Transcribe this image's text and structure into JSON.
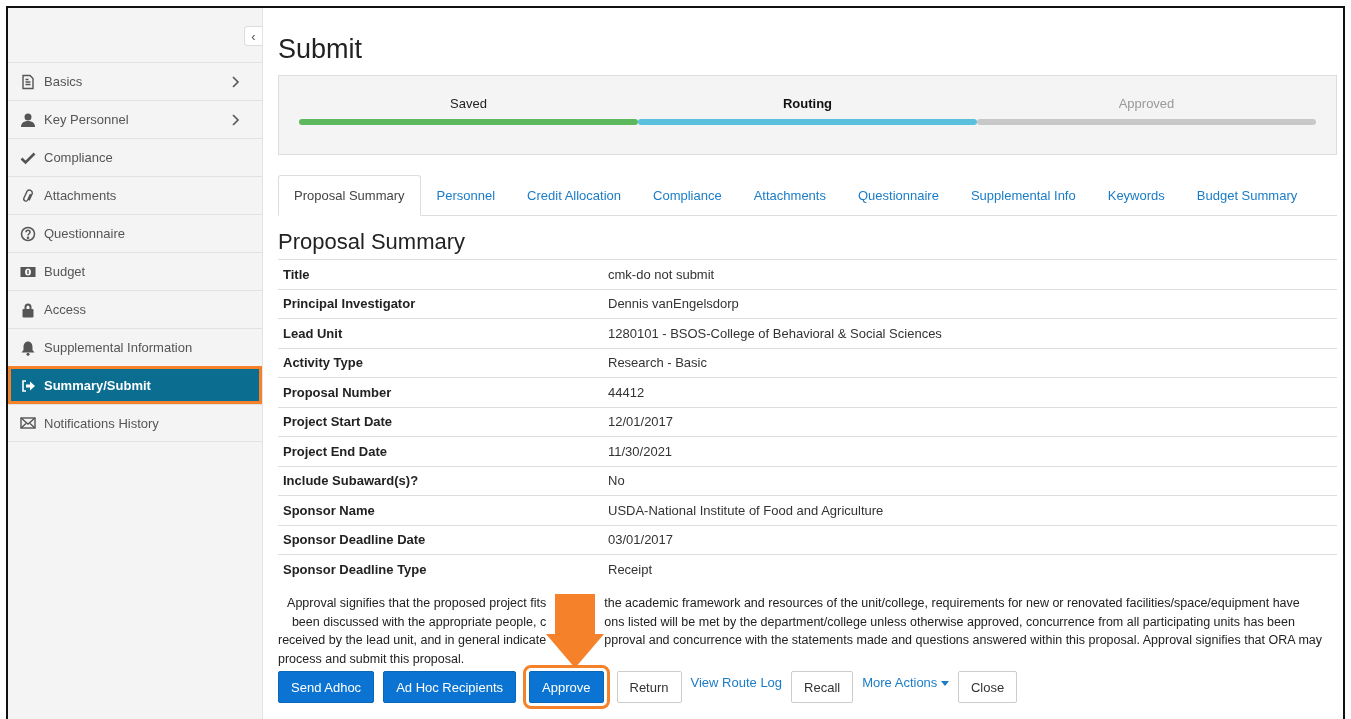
{
  "sidebar": {
    "collapse_icon": "‹",
    "items": [
      {
        "label": "Basics",
        "kind": "document",
        "chevron": true,
        "selected": false
      },
      {
        "label": "Key Personnel",
        "kind": "person",
        "chevron": true,
        "selected": false
      },
      {
        "label": "Compliance",
        "kind": "check",
        "chevron": false,
        "selected": false
      },
      {
        "label": "Attachments",
        "kind": "paperclip",
        "chevron": false,
        "selected": false
      },
      {
        "label": "Questionnaire",
        "kind": "question",
        "chevron": false,
        "selected": false
      },
      {
        "label": "Budget",
        "kind": "money",
        "chevron": false,
        "selected": false
      },
      {
        "label": "Access",
        "kind": "lock",
        "chevron": false,
        "selected": false
      },
      {
        "label": "Supplemental Information",
        "kind": "bell",
        "chevron": false,
        "selected": false
      },
      {
        "label": "Summary/Submit",
        "kind": "signout",
        "chevron": false,
        "selected": true
      },
      {
        "label": "Notifications History",
        "kind": "envelope",
        "chevron": false,
        "selected": false
      }
    ]
  },
  "page_title": "Submit",
  "progress": [
    {
      "label": "Saved",
      "kind": "done"
    },
    {
      "label": "Routing",
      "kind": "current"
    },
    {
      "label": "Approved",
      "kind": "pending"
    }
  ],
  "tabs": [
    {
      "label": "Proposal Summary",
      "selected": true
    },
    {
      "label": "Personnel",
      "selected": false
    },
    {
      "label": "Credit Allocation",
      "selected": false
    },
    {
      "label": "Compliance",
      "selected": false
    },
    {
      "label": "Attachments",
      "selected": false
    },
    {
      "label": "Questionnaire",
      "selected": false
    },
    {
      "label": "Supplemental Info",
      "selected": false
    },
    {
      "label": "Keywords",
      "selected": false
    },
    {
      "label": "Budget Summary",
      "selected": false
    }
  ],
  "section_title": "Proposal Summary",
  "summary": [
    {
      "label": "Title",
      "value": "cmk-do not submit"
    },
    {
      "label": "Principal Investigator",
      "value": "Dennis vanEngelsdorp"
    },
    {
      "label": "Lead Unit",
      "value": "1280101 - BSOS-College of Behavioral & Social Sciences"
    },
    {
      "label": "Activity Type",
      "value": "Research - Basic"
    },
    {
      "label": "Proposal Number",
      "value": "44412"
    },
    {
      "label": "Project Start Date",
      "value": "12/01/2017"
    },
    {
      "label": "Project End Date",
      "value": "11/30/2021"
    },
    {
      "label": "Include Subaward(s)?",
      "value": "No"
    },
    {
      "label": "Sponsor Name",
      "value": "USDA-National Institute of Food and Agriculture"
    },
    {
      "label": "Sponsor Deadline Date",
      "value": "03/01/2017"
    },
    {
      "label": "Sponsor Deadline Type",
      "value": "Receipt"
    }
  ],
  "approval_lines": [
    [
      "Approval signifies that the proposed project fits",
      "the academic framework and resources of the unit/college, requirements for new or renovated facilities/space/equipment have"
    ],
    [
      "been discussed with the appropriate people, c",
      "ons listed will be met by the department/college unless otherwise approved, concurrence from all participating units has been"
    ],
    [
      "received by the lead unit, and in general indicate",
      "pproval and concurrence with the statements made and questions answered within this proposal. Approval signifies that ORA may"
    ],
    [
      "process and submit this proposal."
    ]
  ],
  "actions": [
    {
      "label": "Send Adhoc",
      "kind": "primary",
      "highlighted": false
    },
    {
      "label": "Ad Hoc Recipients",
      "kind": "primary",
      "highlighted": false
    },
    {
      "label": "Approve",
      "kind": "primary",
      "highlighted": true
    },
    {
      "label": "Return",
      "kind": "default",
      "highlighted": false
    },
    {
      "label": "View Route Log",
      "kind": "link",
      "highlighted": false
    },
    {
      "label": "Recall",
      "kind": "default",
      "highlighted": false
    },
    {
      "label": "More Actions",
      "kind": "dropdown",
      "highlighted": false
    },
    {
      "label": "Close",
      "kind": "default",
      "highlighted": false
    }
  ]
}
